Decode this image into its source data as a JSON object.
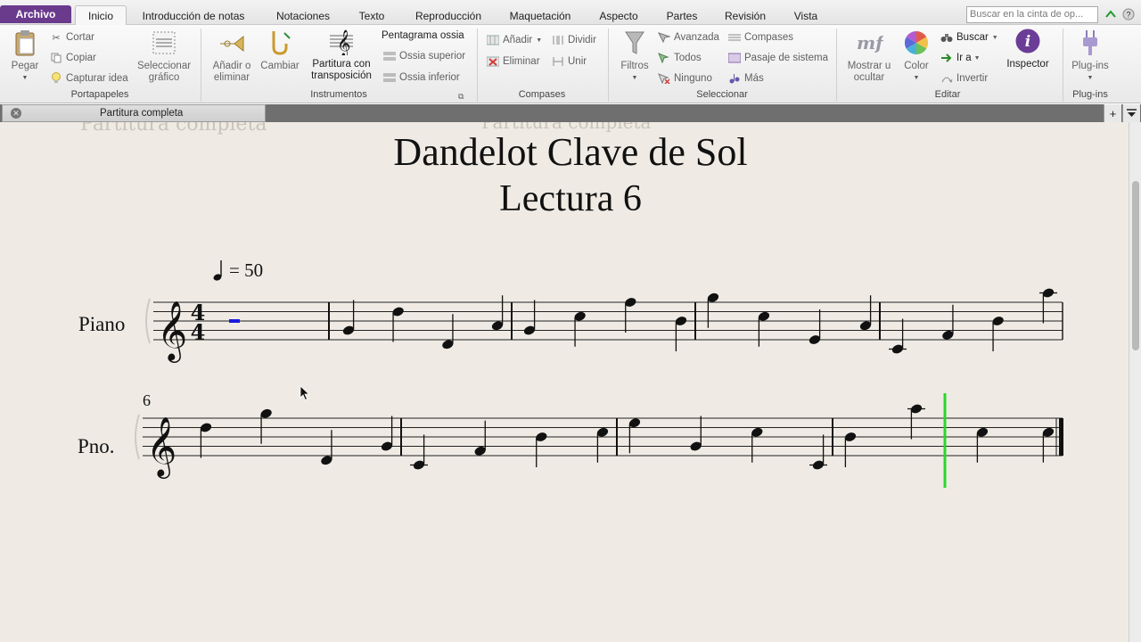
{
  "ribbon_tabs": {
    "archivo": "Archivo",
    "inicio": "Inicio",
    "introduccion": "Introducción de notas",
    "notaciones": "Notaciones",
    "texto": "Texto",
    "reproduccion": "Reproducción",
    "maquetacion": "Maquetación",
    "aspecto": "Aspecto",
    "partes": "Partes",
    "revision": "Revisión",
    "vista": "Vista"
  },
  "search": {
    "placeholder": "Buscar en la cinta de op..."
  },
  "groups": {
    "portapapeles": {
      "label": "Portapapeles",
      "pegar": "Pegar",
      "cortar": "Cortar",
      "copiar": "Copiar",
      "capturar": "Capturar idea",
      "seleccionar_grafico": [
        "Seleccionar",
        "gráfico"
      ]
    },
    "instrumentos": {
      "label": "Instrumentos",
      "anadir_eliminar": [
        "Añadir o",
        "eliminar"
      ],
      "cambiar": "Cambiar",
      "partitura_transposicion": [
        "Partitura con",
        "transposición"
      ],
      "pentagrama_ossia": "Pentagrama ossia",
      "ossia_superior": "Ossia superior",
      "ossia_inferior": "Ossia inferior"
    },
    "compases": {
      "label": "Compases",
      "anadir": "Añadir",
      "eliminar": "Eliminar",
      "dividir": "Dividir",
      "unir": "Unir"
    },
    "seleccionar": {
      "label": "Seleccionar",
      "filtros": "Filtros",
      "avanzada": "Avanzada",
      "todos": "Todos",
      "ninguno": "Ninguno",
      "compases": "Compases",
      "pasaje": "Pasaje de sistema",
      "mas": "Más"
    },
    "editar": {
      "label": "Editar",
      "mostrar_ocultar": [
        "Mostrar u",
        "ocultar"
      ],
      "color": "Color",
      "buscar": "Buscar",
      "ir_a": "Ir a",
      "invertir": "Invertir",
      "inspector": "Inspector"
    },
    "plugins": {
      "label": "Plug-ins",
      "plugins": "Plug-ins"
    }
  },
  "document_tab": {
    "label": "Partitura completa"
  },
  "score": {
    "ghost_header_left": "Partitura completa",
    "ghost_header_center": "Partitura completa",
    "title": "Dandelot Clave de Sol",
    "subtitle": "Lectura 6",
    "tempo": "= 50",
    "instrument_full": "Piano",
    "instrument_short": "Pno.",
    "time_signature": {
      "numerator": "4",
      "denominator": "4"
    },
    "second_system_bar_number": "6",
    "system1_notes": [
      [
        "G4",
        "D5",
        "D4",
        "A4"
      ],
      [
        "G4",
        "C5",
        "F5",
        "B4"
      ],
      [
        "G5",
        "C5",
        "E4",
        "A4"
      ],
      [
        "C4",
        "F4",
        "B4",
        "A5"
      ]
    ],
    "system2_notes": [
      [
        "D5",
        "G5",
        "D4",
        "G4"
      ],
      [
        "C4",
        "F4",
        "B4",
        "C5"
      ],
      [
        "E5",
        "G4",
        "C5",
        "C4"
      ],
      [
        "B4",
        "A5",
        "C5",
        "C5"
      ]
    ]
  },
  "colors": {
    "archivo_tab": "#6a3a8c",
    "paper": "#efebe4",
    "playback_line": "#2bd62b",
    "selection": "#1a1adf"
  }
}
